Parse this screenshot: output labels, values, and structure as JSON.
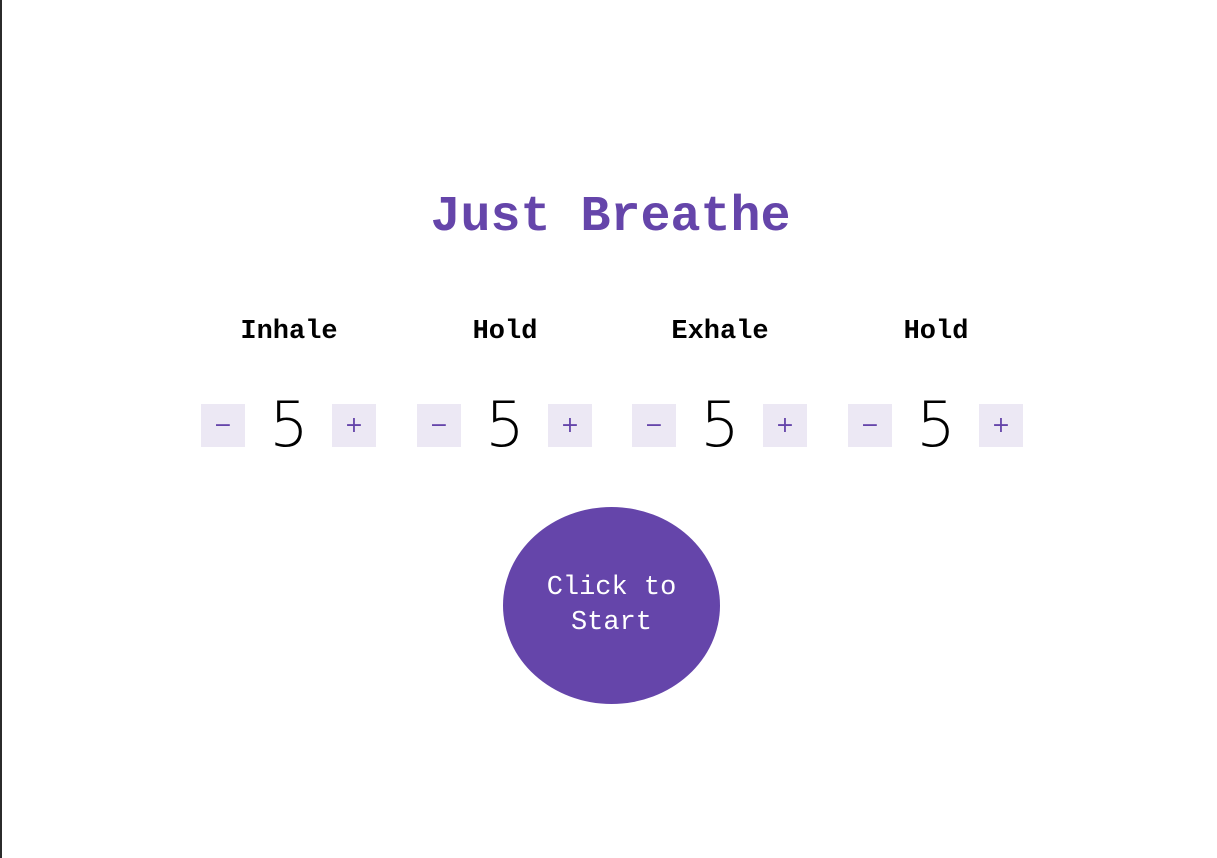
{
  "app": {
    "title": "Just Breathe"
  },
  "phases": [
    {
      "label": "Inhale",
      "value": "5",
      "minus": "−",
      "plus": "+"
    },
    {
      "label": "Hold",
      "value": "5",
      "minus": "−",
      "plus": "+"
    },
    {
      "label": "Exhale",
      "value": "5",
      "minus": "−",
      "plus": "+"
    },
    {
      "label": "Hold",
      "value": "5",
      "minus": "−",
      "plus": "+"
    }
  ],
  "start_button": {
    "label": "Click to Start"
  },
  "colors": {
    "accent": "#6545aa",
    "button_bg": "#ece8f4",
    "text": "#000000",
    "background": "#ffffff"
  }
}
